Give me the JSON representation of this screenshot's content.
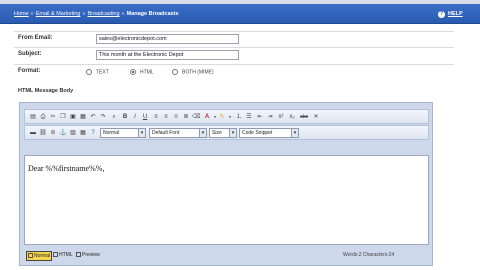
{
  "breadcrumb": {
    "items": [
      "Home",
      "Email & Marketing",
      "Broadcasting"
    ],
    "separator": "»",
    "current": "Manage Broadcasts"
  },
  "help": {
    "label": "HELP"
  },
  "form": {
    "from_email": {
      "label": "From Email:",
      "value": "sales@electronicdepot.com"
    },
    "subject": {
      "label": "Subject:",
      "value": "This month at the Electronic Depot"
    },
    "format": {
      "label": "Format:",
      "options": [
        "TEXT",
        "HTML",
        "BOTH (MIME)"
      ],
      "selected": "HTML"
    },
    "message_body_label": "HTML Message Body"
  },
  "editor": {
    "toolbar1_icons": [
      "new-doc-icon",
      "print-icon",
      "cut-icon",
      "copy-icon",
      "paste-icon",
      "paste-text-icon",
      "undo-icon",
      "redo-icon",
      "find-icon",
      "bold-icon",
      "italic-icon",
      "underline-icon",
      "align-left-icon",
      "align-center-icon",
      "align-right-icon",
      "align-justify-icon",
      "clear-format-icon",
      "font-color-icon",
      "highlight-icon",
      "ordered-list-icon",
      "unordered-list-icon",
      "outdent-icon",
      "indent-icon",
      "superscript-icon",
      "subscript-icon",
      "strikethrough-icon",
      "remove-format-icon"
    ],
    "toolbar2_icons": [
      "horizontal-rule-icon",
      "link-icon",
      "unlink-icon",
      "anchor-icon",
      "image-icon",
      "table-icon",
      "help-icon"
    ],
    "paragraph_select": "Normal",
    "font_select": "Default Font",
    "size_select": "Size",
    "snippet_select": "Code Snippet",
    "content": "Dear %%firstname%%,",
    "footer_tabs": [
      "Normal",
      "HTML",
      "Preview"
    ],
    "active_tab": "Normal",
    "counts": "Words:2 Characters:24"
  },
  "colors": {
    "topbar": "#2a5bb0",
    "editor_frame": "#cdd8ea",
    "active_tab": "#f5d64a"
  }
}
